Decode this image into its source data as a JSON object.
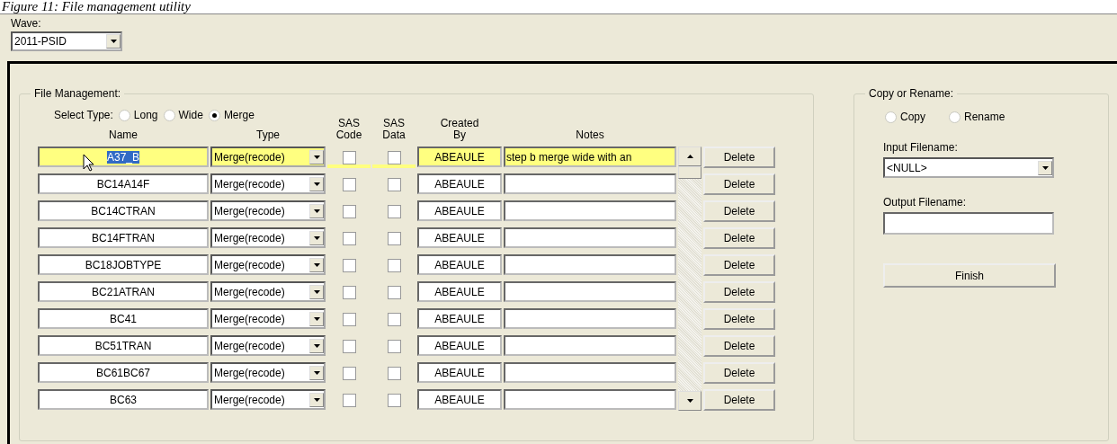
{
  "caption": "Figure 11: File management utility",
  "wave": {
    "label": "Wave:",
    "value": "2011-PSID"
  },
  "file_management": {
    "title": "File Management:",
    "select_type": {
      "label": "Select Type:",
      "options": [
        {
          "label": "Long",
          "selected": false
        },
        {
          "label": "Wide",
          "selected": false
        },
        {
          "label": "Merge",
          "selected": true
        }
      ]
    },
    "columns": [
      "Name",
      "Type",
      "SAS Code",
      "SAS Data",
      "Created By",
      "Notes"
    ],
    "rows": [
      {
        "name": "A37_B",
        "type": "Merge(recode)",
        "sas_code": false,
        "sas_data": false,
        "created_by": "ABEAULE",
        "notes": "step b merge wide with an",
        "delete": "Delete",
        "selected": true
      },
      {
        "name": "BC14A14F",
        "type": "Merge(recode)",
        "sas_code": false,
        "sas_data": false,
        "created_by": "ABEAULE",
        "delete": "Delete",
        "selected": false
      },
      {
        "name": "BC14CTRAN",
        "type": "Merge(recode)",
        "sas_code": false,
        "sas_data": false,
        "created_by": "ABEAULE",
        "delete": "Delete",
        "selected": false
      },
      {
        "name": "BC14FTRAN",
        "type": "Merge(recode)",
        "sas_code": false,
        "sas_data": false,
        "created_by": "ABEAULE",
        "delete": "Delete",
        "selected": false
      },
      {
        "name": "BC18JOBTYPE",
        "type": "Merge(recode)",
        "sas_code": false,
        "sas_data": false,
        "created_by": "ABEAULE",
        "delete": "Delete",
        "selected": false
      },
      {
        "name": "BC21ATRAN",
        "type": "Merge(recode)",
        "sas_code": false,
        "sas_data": false,
        "created_by": "ABEAULE",
        "delete": "Delete",
        "selected": false
      },
      {
        "name": "BC41",
        "type": "Merge(recode)",
        "sas_code": false,
        "sas_data": false,
        "created_by": "ABEAULE",
        "delete": "Delete",
        "selected": false
      },
      {
        "name": "BC51TRAN",
        "type": "Merge(recode)",
        "sas_code": false,
        "sas_data": false,
        "created_by": "ABEAULE",
        "delete": "Delete",
        "selected": false
      },
      {
        "name": "BC61BC67",
        "type": "Merge(recode)",
        "sas_code": false,
        "sas_data": false,
        "created_by": "ABEAULE",
        "delete": "Delete",
        "selected": false
      },
      {
        "name": "BC63",
        "type": "Merge(recode)",
        "sas_code": false,
        "sas_data": false,
        "created_by": "ABEAULE",
        "delete": "Delete",
        "selected": false
      }
    ]
  },
  "copy_rename": {
    "title": "Copy or Rename:",
    "options": [
      {
        "label": "Copy",
        "selected": false
      },
      {
        "label": "Rename",
        "selected": false
      }
    ],
    "input_label": "Input Filename:",
    "input_value": "<NULL>",
    "output_label": "Output Filename:",
    "finish": "Finish"
  }
}
